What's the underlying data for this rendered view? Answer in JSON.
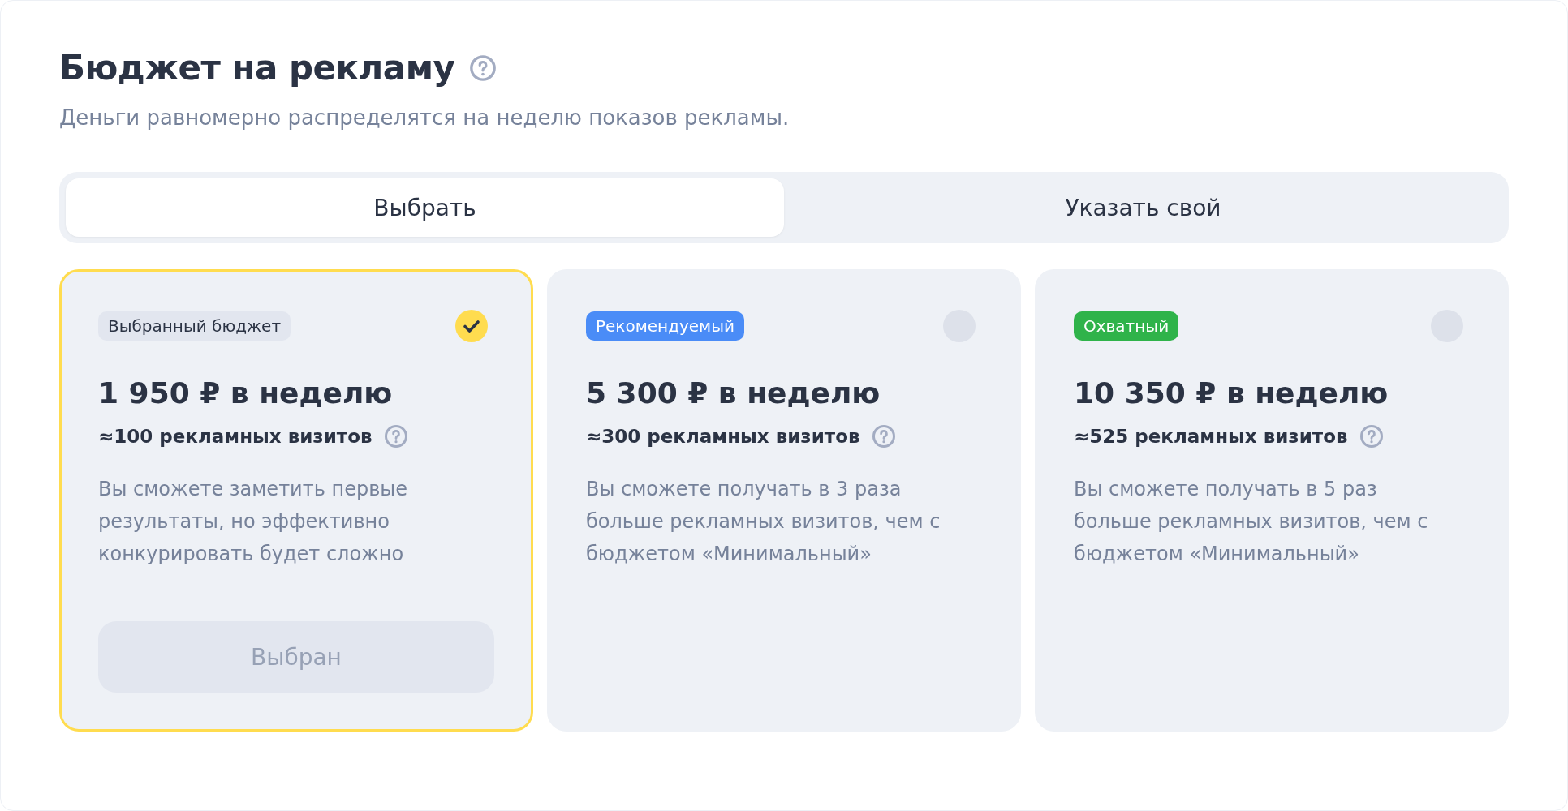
{
  "title": "Бюджет на рекламу",
  "subtitle": "Деньги равномерно распределятся на неделю показов рекламы.",
  "tabs": [
    {
      "label": "Выбрать",
      "selected": true
    },
    {
      "label": "Указать свой",
      "selected": false
    }
  ],
  "cards": [
    {
      "selected": true,
      "badge": {
        "label": "Выбранный бюджет",
        "color": "#e2e6ef"
      },
      "price": "1 950 ₽ в неделю",
      "visits": "≈100 рекламных визитов",
      "description": "Вы сможете заметить первые результаты, но эффективно конкурировать будет сложно",
      "button": {
        "label": "Выбран",
        "disabled": true
      }
    },
    {
      "selected": false,
      "badge": {
        "label": "Рекомендуемый",
        "color": "#4a8cf7"
      },
      "price": "5 300 ₽ в неделю",
      "visits": "≈300 рекламных визитов",
      "description": "Вы сможете получать в 3 раза больше рекламных визитов, чем с бюджетом «Минимальный»"
    },
    {
      "selected": false,
      "badge": {
        "label": "Охватный",
        "color": "#2fb34a"
      },
      "price": "10 350 ₽ в неделю",
      "visits": "≈525 рекламных визитов",
      "description": "Вы сможете получать в 5 раз больше рекламных визитов, чем с бюджетом «Минимальный»"
    }
  ]
}
